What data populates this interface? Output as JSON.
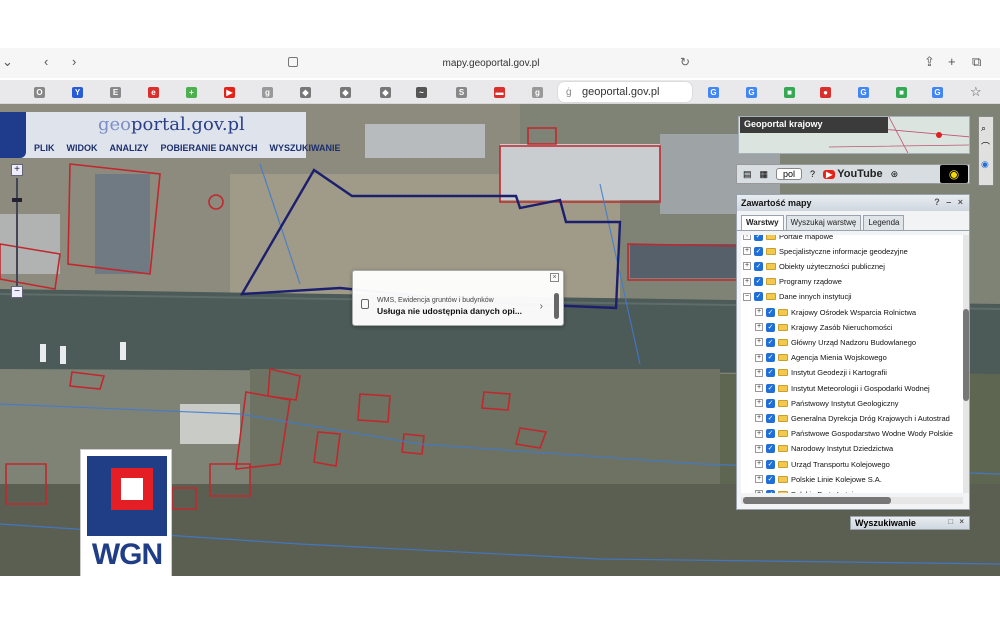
{
  "browser": {
    "url": "mapy.geoportal.gov.pl",
    "active_tab_title": "geoportal.gov.pl",
    "back_icon": "chevron-left-icon",
    "forward_icon": "chevron-right-icon",
    "share_icon": "share-icon",
    "new_tab_icon": "plus-icon",
    "tabs_icon": "tabs-overview-icon",
    "bookmark_icon": "star-icon"
  },
  "geoportal": {
    "logo_prefix": "geo",
    "logo_suffix": "portal.gov.pl",
    "menu": [
      "PLIK",
      "WIDOK",
      "ANALIZY",
      "POBIERANIE DANYCH",
      "WYSZUKIWANIE"
    ],
    "overview_title": "Geoportal krajowy",
    "language": "pol",
    "youtube_label": "YouTube"
  },
  "layers_panel": {
    "title": "Zawartość mapy",
    "tabs": [
      "Warstwy",
      "Wyszukaj warstwę",
      "Legenda"
    ],
    "items": [
      {
        "label": "Portale mapowe",
        "level": 0
      },
      {
        "label": "Specjalistyczne informacje geodezyjne",
        "level": 0
      },
      {
        "label": "Obiekty użyteczności publicznej",
        "level": 0
      },
      {
        "label": "Programy rządowe",
        "level": 0
      },
      {
        "label": "Dane innych instytucji",
        "level": 0
      },
      {
        "label": "Krajowy Ośrodek Wsparcia Rolnictwa",
        "level": 1
      },
      {
        "label": "Krajowy Zasób Nieruchomości",
        "level": 1
      },
      {
        "label": "Główny Urząd Nadzoru Budowlanego",
        "level": 1
      },
      {
        "label": "Agencja Mienia Wojskowego",
        "level": 1
      },
      {
        "label": "Instytut Geodezji i Kartografii",
        "level": 1
      },
      {
        "label": "Instytut Meteorologii i Gospodarki Wodnej",
        "level": 1
      },
      {
        "label": "Państwowy Instytut Geologiczny",
        "level": 1
      },
      {
        "label": "Generalna Dyrekcja Dróg Krajowych i Autostrad",
        "level": 1
      },
      {
        "label": "Państwowe Gospodarstwo Wodne Wody Polskie",
        "level": 1
      },
      {
        "label": "Narodowy Instytut Dziedzictwa",
        "level": 1
      },
      {
        "label": "Urząd Transportu Kolejowego",
        "level": 1
      },
      {
        "label": "Polskie Linie Kolejowe S.A.",
        "level": 1
      },
      {
        "label": "Polskie Porty Lotnicze",
        "level": 1
      }
    ]
  },
  "search_panel": {
    "title": "Wyszukiwanie"
  },
  "popup": {
    "subtitle": "WMS, Ewidencja gruntów i budynków",
    "message": "Usługa nie udostępnia danych opi..."
  },
  "watermark_logo": {
    "text": "WGN"
  },
  "colors": {
    "parcel_outline": "#c0282e",
    "selected_plot": "#1c1f6e",
    "brand_blue": "#1f3e86",
    "brand_red": "#e31e24"
  }
}
